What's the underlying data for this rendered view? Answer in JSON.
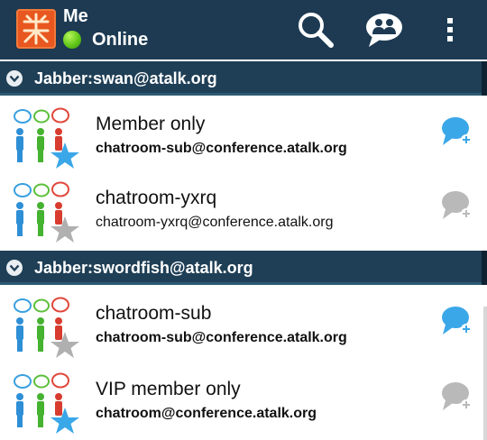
{
  "account": {
    "name": "Me",
    "status": "Online",
    "logo_icon": "app-logo-icon"
  },
  "toolbar": {
    "search_icon": "search-icon",
    "chat_icon": "chat-rooms-icon",
    "menu_icon": "overflow-menu-icon"
  },
  "colors": {
    "appbar": "#1d3a52",
    "group_header": "#1f3f56",
    "online": "#62c81a",
    "bubble_active": "#3aa7e8",
    "bubble_inactive": "#b9b9b9",
    "star_bookmarked": "#3aa7e8",
    "star_not_bookmarked": "#b0b0b0"
  },
  "groups": [
    {
      "label": "Jabber:swan@atalk.org",
      "rooms": [
        {
          "title": "Member only",
          "jid": "chatroom-sub@conference.atalk.org",
          "jid_bold": true,
          "joined": true,
          "bookmarked": true
        },
        {
          "title": "chatroom-yxrq",
          "jid": "chatroom-yxrq@conference.atalk.org",
          "jid_bold": false,
          "joined": false,
          "bookmarked": false
        }
      ]
    },
    {
      "label": "Jabber:swordfish@atalk.org",
      "rooms": [
        {
          "title": "chatroom-sub",
          "jid": "chatroom-sub@conference.atalk.org",
          "jid_bold": true,
          "joined": true,
          "bookmarked": false
        },
        {
          "title": "VIP member only",
          "jid": "chatroom@conference.atalk.org",
          "jid_bold": true,
          "joined": false,
          "bookmarked": true
        }
      ]
    }
  ]
}
